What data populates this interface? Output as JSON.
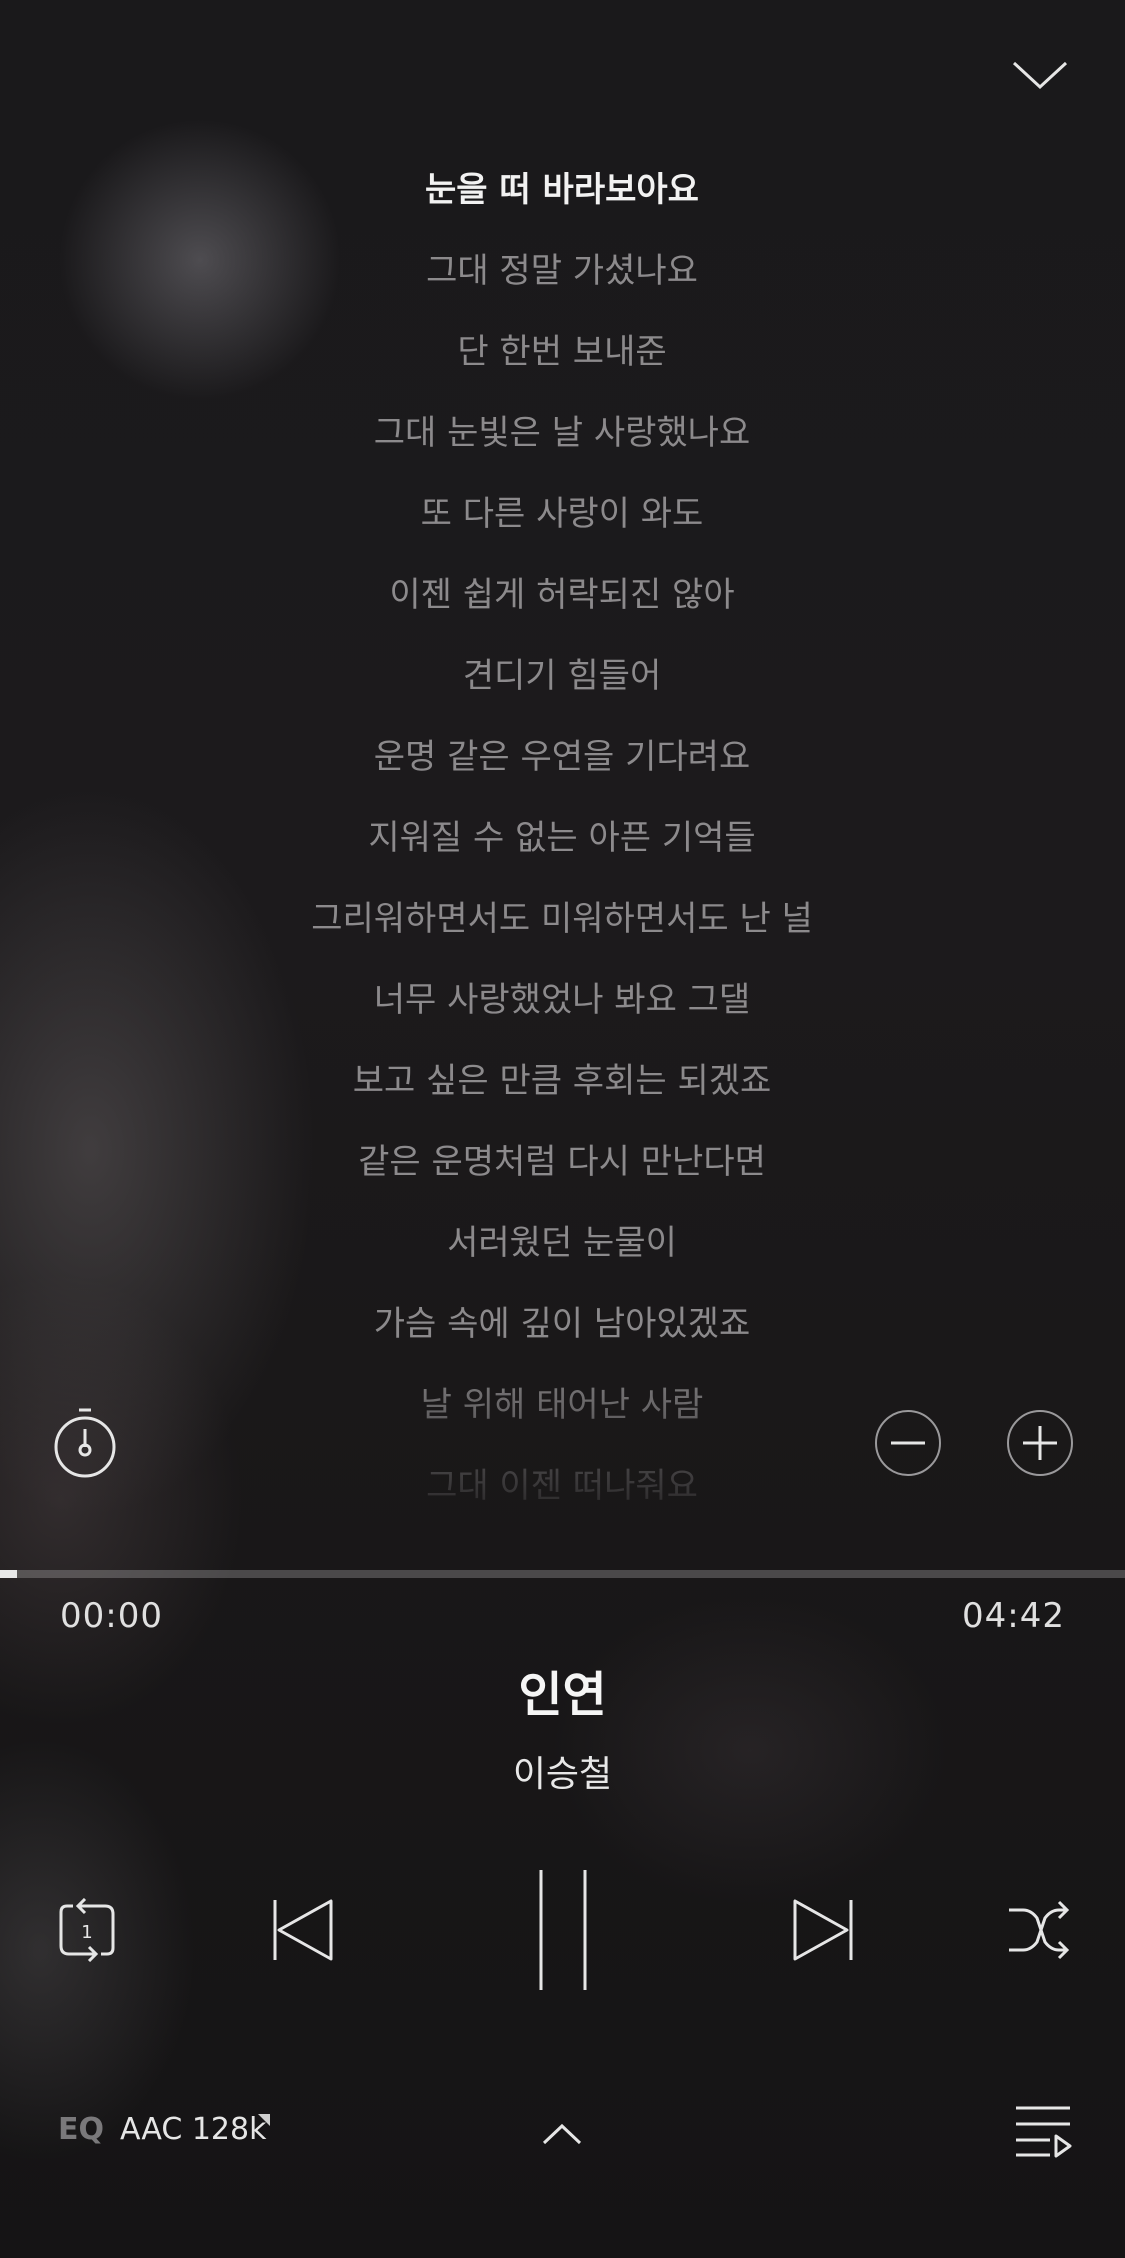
{
  "lyrics": [
    "눈을 떠 바라보아요",
    "그대 정말 가셨나요",
    "단 한번 보내준",
    "그대 눈빛은 날 사랑했나요",
    "또 다른 사랑이 와도",
    "이젠 쉽게 허락되진 않아",
    "견디기 힘들어",
    "운명 같은 우연을 기다려요",
    "지워질 수 없는 아픈 기억들",
    "그리워하면서도 미워하면서도 난 널",
    "너무 사랑했었나 봐요 그댈",
    "보고 싶은 만큼 후회는 되겠죠",
    "같은 운명처럼 다시 만난다면",
    "서러웠던 눈물이",
    "가슴 속에 깊이 남아있겠죠",
    "날 위해 태어난 사람",
    "그대 이젠 떠나줘요"
  ],
  "current_lyric_index": 0,
  "player": {
    "elapsed": "00:00",
    "total": "04:42",
    "progress_fraction": 0.015,
    "title": "인연",
    "artist": "이승철",
    "repeat_mode": "1"
  },
  "footer": {
    "eq_label": "EQ",
    "quality_label": "AAC 128k"
  },
  "icons": {
    "collapse": "chevron-down-icon",
    "timer": "stopwatch-icon",
    "font_minus": "minus-circle-icon",
    "font_plus": "plus-circle-icon",
    "repeat": "repeat-one-icon",
    "prev": "skip-previous-icon",
    "pause": "pause-icon",
    "next": "skip-next-icon",
    "shuffle": "shuffle-icon",
    "expand": "chevron-up-icon",
    "playlist": "playlist-icon"
  },
  "colors": {
    "current_lyric": "#f2f2f2",
    "lyric": "#8c8a8c",
    "progress_fill": "#e8e8e8"
  }
}
